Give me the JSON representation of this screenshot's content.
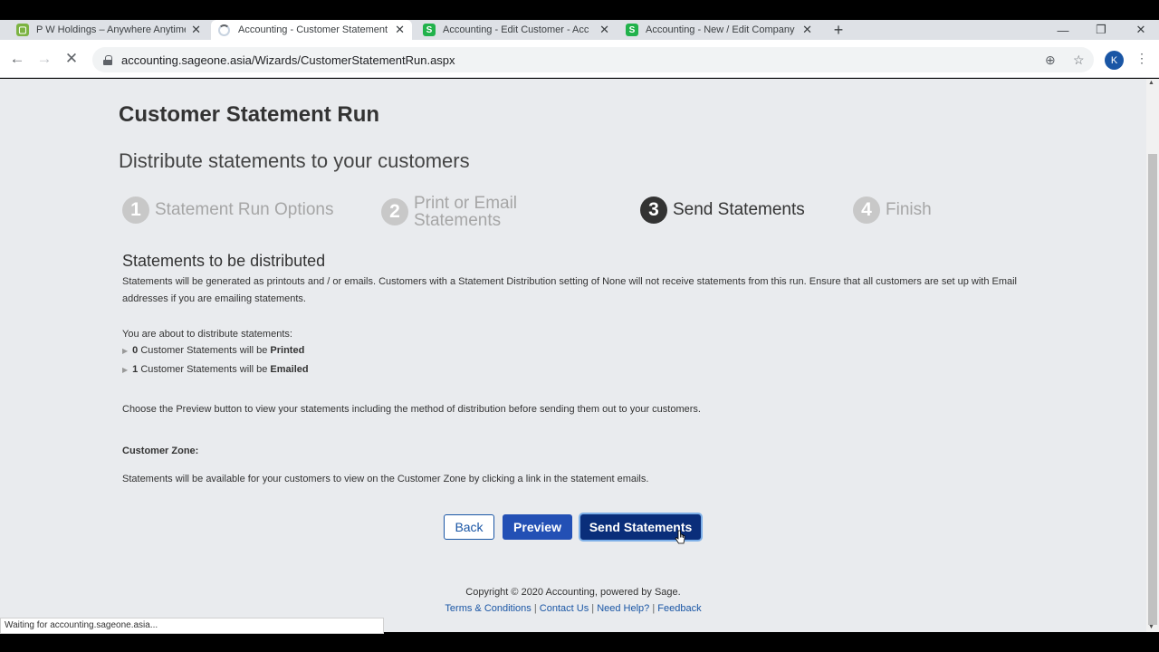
{
  "browser": {
    "tabs": [
      {
        "title": "P W Holdings – Anywhere Anytime",
        "favicon_color": "#7cb342",
        "favicon": "square",
        "active": false
      },
      {
        "title": "Accounting - Customer Statement",
        "favicon": "spinner",
        "active": true
      },
      {
        "title": "Accounting - Edit Customer - Acc",
        "favicon_color": "#21b24b",
        "favicon": "S",
        "active": false
      },
      {
        "title": "Accounting - New / Edit Company",
        "favicon_color": "#21b24b",
        "favicon": "S",
        "active": false
      }
    ],
    "url": "accounting.sageone.asia/Wizards/CustomerStatementRun.aspx",
    "avatar_letter": "K",
    "status_text": "Waiting for accounting.sageone.asia..."
  },
  "page": {
    "title": "Customer Statement Run",
    "subtitle": "Distribute statements to your customers",
    "steps": [
      {
        "number": "1",
        "label": "Statement Run Options",
        "current": false
      },
      {
        "number": "2",
        "label": "Print or Email Statements",
        "current": false
      },
      {
        "number": "3",
        "label": "Send Statements",
        "current": true
      },
      {
        "number": "4",
        "label": "Finish",
        "current": false
      }
    ],
    "section_title": "Statements to be distributed",
    "intro": "Statements will be generated as printouts and / or emails. Customers with a Statement Distribution setting of None will not receive statements from this run. Ensure that all customers are set up with Email addresses if you are emailing statements.",
    "about": "You are about to distribute statements:",
    "printed": {
      "count": "0",
      "text": "Customer Statements will be",
      "method": "Printed"
    },
    "emailed": {
      "count": "1",
      "text": "Customer Statements will be",
      "method": "Emailed"
    },
    "preview_note": "Choose the Preview button to view your statements including the method of distribution before sending them out to your customers.",
    "customer_zone_label": "Customer Zone:",
    "customer_zone_text": "Statements will be available for your customers to view on the Customer Zone by clicking a link in the statement emails.",
    "buttons": {
      "back": "Back",
      "preview": "Preview",
      "send": "Send Statements"
    },
    "footer": {
      "copyright": "Copyright © 2020 Accounting, powered by Sage.",
      "links": [
        "Terms & Conditions",
        "Contact Us",
        "Need Help?",
        "Feedback"
      ]
    }
  },
  "colors": {
    "accent": "#1a56a5",
    "primary_button": "#2350b5",
    "send_button": "#0a2e7a",
    "page_bg": "#e9ebee"
  }
}
